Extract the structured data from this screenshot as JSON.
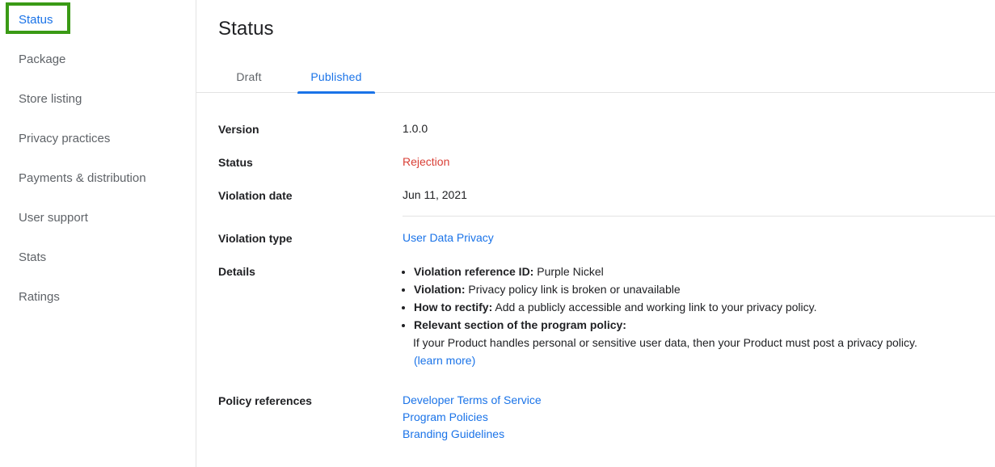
{
  "sidebar": {
    "items": [
      {
        "label": "Status",
        "active": true,
        "highlighted": true
      },
      {
        "label": "Package",
        "active": false,
        "highlighted": false
      },
      {
        "label": "Store listing",
        "active": false,
        "highlighted": false
      },
      {
        "label": "Privacy practices",
        "active": false,
        "highlighted": false
      },
      {
        "label": "Payments & distribution",
        "active": false,
        "highlighted": false
      },
      {
        "label": "User support",
        "active": false,
        "highlighted": false
      },
      {
        "label": "Stats",
        "active": false,
        "highlighted": false
      },
      {
        "label": "Ratings",
        "active": false,
        "highlighted": false
      }
    ],
    "highlight_color": "#3a9a15"
  },
  "main": {
    "title": "Status",
    "tabs": [
      {
        "label": "Draft",
        "active": false
      },
      {
        "label": "Published",
        "active": true
      }
    ],
    "accent_color": "#1a73e8",
    "rejection_color": "#d93f36",
    "fields": {
      "version_label": "Version",
      "version_value": "1.0.0",
      "status_label": "Status",
      "status_value": "Rejection",
      "violation_date_label": "Violation date",
      "violation_date_value": "Jun 11, 2021",
      "violation_type_label": "Violation type",
      "violation_type_value": "User Data Privacy",
      "details_label": "Details",
      "policy_references_label": "Policy references"
    },
    "details_bullets": [
      {
        "term": "Violation reference ID:",
        "text": " Purple Nickel"
      },
      {
        "term": "Violation:",
        "text": " Privacy policy link is broken or unavailable"
      },
      {
        "term": "How to rectify:",
        "text": " Add a publicly accessible and working link to your privacy policy."
      },
      {
        "term": "Relevant section of the program policy:",
        "text": ""
      }
    ],
    "details_subtext": "If your Product handles personal or sensitive user data, then your Product must post a privacy policy.",
    "details_learn_more": "(learn more)",
    "policy_references": [
      "Developer Terms of Service",
      "Program Policies",
      "Branding Guidelines"
    ]
  }
}
